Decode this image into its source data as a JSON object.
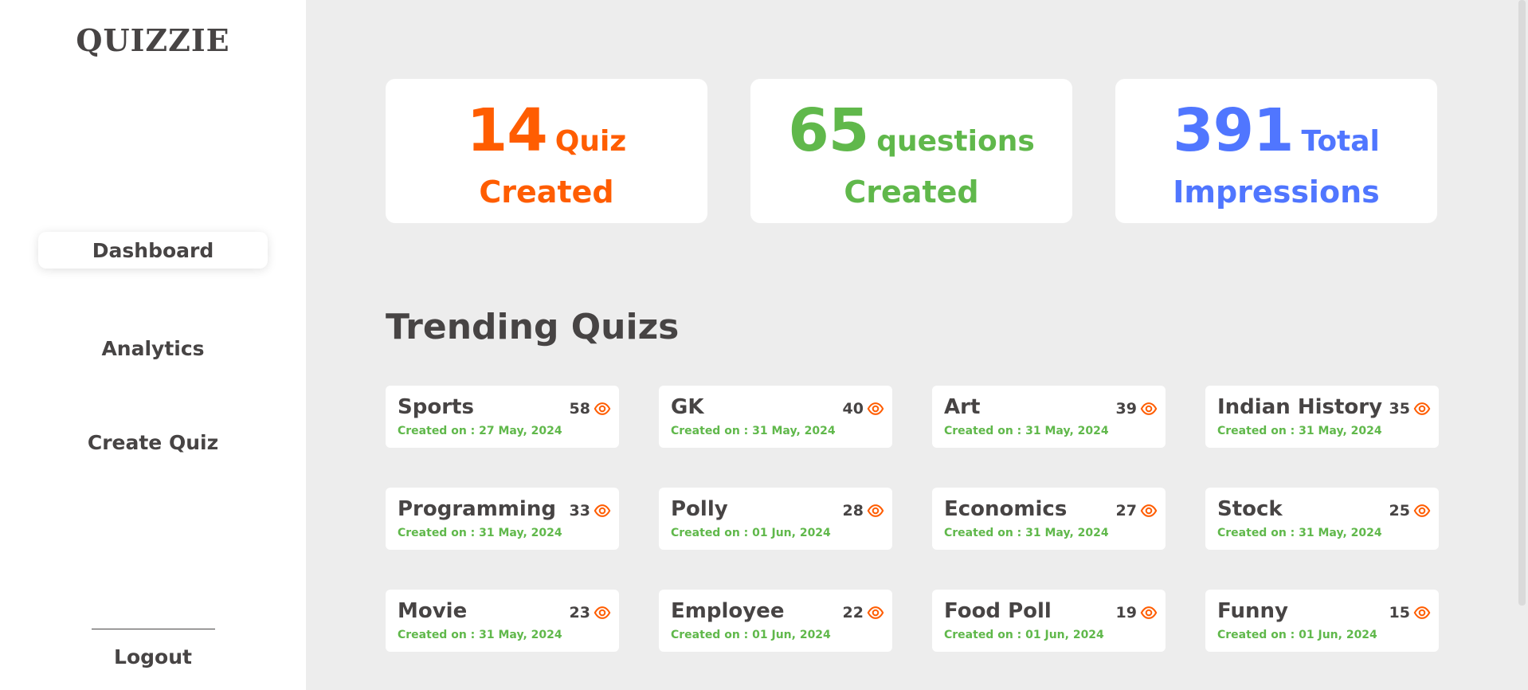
{
  "app": {
    "logo": "QUIZZIE"
  },
  "sidebar": {
    "items": [
      {
        "label": "Dashboard",
        "active": true
      },
      {
        "label": "Analytics",
        "active": false
      },
      {
        "label": "Create Quiz",
        "active": false
      }
    ],
    "logout_label": "Logout"
  },
  "stats": [
    {
      "value": "14",
      "unit": "Quiz",
      "label": "Created",
      "color": "#ff5d01"
    },
    {
      "value": "65",
      "unit": "questions",
      "label": "Created",
      "color": "#60b84b"
    },
    {
      "value": "391",
      "unit": "Total",
      "label": "Impressions",
      "color": "#5076ff"
    }
  ],
  "trending": {
    "title": "Trending Quizs",
    "quizzes": [
      {
        "name": "Sports",
        "views": "58",
        "created": "Created on : 27 May, 2024"
      },
      {
        "name": "GK",
        "views": "40",
        "created": "Created on : 31 May, 2024"
      },
      {
        "name": "Art",
        "views": "39",
        "created": "Created on : 31 May, 2024"
      },
      {
        "name": "Indian History",
        "views": "35",
        "created": "Created on : 31 May, 2024"
      },
      {
        "name": "Programming",
        "views": "33",
        "created": "Created on : 31 May, 2024"
      },
      {
        "name": "Polly",
        "views": "28",
        "created": "Created on : 01 Jun, 2024"
      },
      {
        "name": "Economics",
        "views": "27",
        "created": "Created on : 31 May, 2024"
      },
      {
        "name": "Stock",
        "views": "25",
        "created": "Created on : 31 May, 2024"
      },
      {
        "name": "Movie",
        "views": "23",
        "created": "Created on : 31 May, 2024"
      },
      {
        "name": "Employee",
        "views": "22",
        "created": "Created on : 01 Jun, 2024"
      },
      {
        "name": "Food Poll",
        "views": "19",
        "created": "Created on : 01 Jun, 2024"
      },
      {
        "name": "Funny",
        "views": "15",
        "created": "Created on : 01 Jun, 2024"
      }
    ],
    "icon": "eye-icon",
    "icon_color": "#ff5d01"
  }
}
